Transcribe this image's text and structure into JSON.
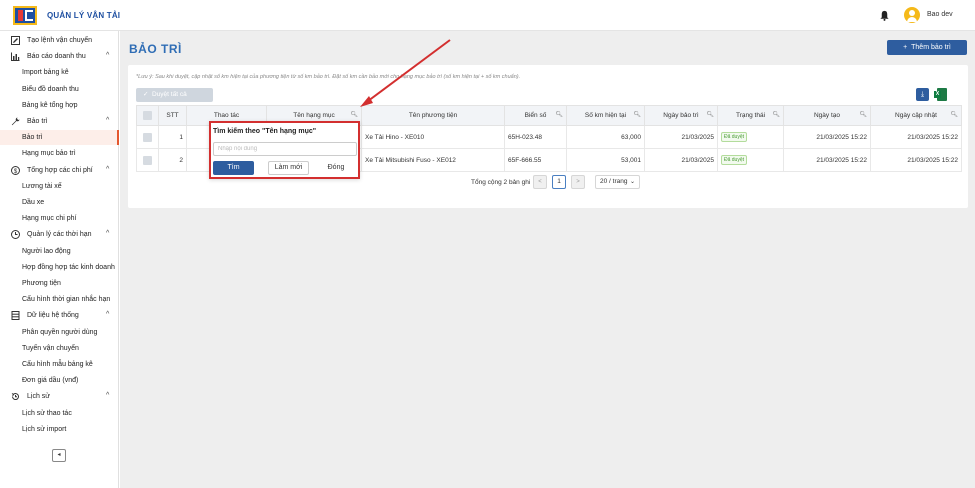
{
  "app": {
    "title": "QUẢN LÝ VẬN TẢI",
    "user": "Bao dev"
  },
  "sidebar": {
    "items": [
      {
        "type": "group",
        "label": "Tạo lệnh vận chuyển",
        "icon": "edit-icon",
        "chevron": ""
      },
      {
        "type": "group",
        "label": "Báo cáo doanh thu",
        "icon": "bar-chart-icon",
        "chevron": "^"
      },
      {
        "type": "sub",
        "label": "Import bảng kê"
      },
      {
        "type": "sub",
        "label": "Biểu đồ doanh thu"
      },
      {
        "type": "sub",
        "label": "Bảng kê tổng hợp"
      },
      {
        "type": "group",
        "label": "Bảo trì",
        "icon": "wrench-icon",
        "chevron": "^"
      },
      {
        "type": "sub",
        "label": "Bảo trì",
        "active": true
      },
      {
        "type": "sub",
        "label": "Hạng mục bảo trì"
      },
      {
        "type": "group",
        "label": "Tổng hợp các chi phí",
        "icon": "money-icon",
        "chevron": "^"
      },
      {
        "type": "sub",
        "label": "Lương tài xế"
      },
      {
        "type": "sub",
        "label": "Dầu xe"
      },
      {
        "type": "sub",
        "label": "Hạng mục chi phí"
      },
      {
        "type": "group",
        "label": "Quản lý các thời hạn",
        "icon": "clock-icon",
        "chevron": "^"
      },
      {
        "type": "sub",
        "label": "Người lao động"
      },
      {
        "type": "sub",
        "label": "Hợp đồng hợp tác kinh doanh"
      },
      {
        "type": "sub",
        "label": "Phương tiện"
      },
      {
        "type": "sub",
        "label": "Cấu hình thời gian nhắc hạn"
      },
      {
        "type": "group",
        "label": "Dữ liệu hệ thống",
        "icon": "database-icon",
        "chevron": "^"
      },
      {
        "type": "sub",
        "label": "Phân quyền người dùng"
      },
      {
        "type": "sub",
        "label": "Tuyến vận chuyển"
      },
      {
        "type": "sub",
        "label": "Cấu hình mẫu bảng kê"
      },
      {
        "type": "sub",
        "label": "Đơn giá dầu (vnđ)"
      },
      {
        "type": "group",
        "label": "Lịch sử",
        "icon": "history-icon",
        "chevron": "^"
      },
      {
        "type": "sub",
        "label": "Lịch sử thao tác"
      },
      {
        "type": "sub",
        "label": "Lịch sử import"
      }
    ],
    "collapse": "◂"
  },
  "page": {
    "title": "BẢO TRÌ",
    "add_button": "Thêm bảo trì",
    "note": "*Lưu ý: Sau khi duyệt, cập nhật số km hiện tại của phương tiện từ số km bảo trì. Đặt số km cần bảo mới cho hạng mục bảo trì (số km hiện tại + số km chuẩn).",
    "approve_all": "Duyệt tất cả"
  },
  "table": {
    "headers": [
      "",
      "STT",
      "Thao tác",
      "Tên hạng mục",
      "Tên phương tiện",
      "Biển số",
      "Số km hiện tại",
      "Ngày bảo trì",
      "Trạng thái",
      "Ngày tạo",
      "Ngày cập nhật"
    ],
    "rows": [
      {
        "stt": "1",
        "vehicle": "Xe Tải Hino - XE010",
        "plate": "65H-023.48",
        "km": "63,000",
        "date": "21/03/2025",
        "status": "Đã duyệt",
        "created": "21/03/2025 15:22",
        "updated": "21/03/2025 15:22"
      },
      {
        "stt": "2",
        "vehicle": "Xe Tải Mitsubishi Fuso - XE012",
        "plate": "65F-666.55",
        "km": "53,001",
        "date": "21/03/2025",
        "status": "Đã duyệt",
        "created": "21/03/2025 15:22",
        "updated": "21/03/2025 15:22"
      }
    ]
  },
  "pager": {
    "total": "Tổng cộng 2 bản ghi",
    "prev": "<",
    "page": "1",
    "next": ">",
    "size": "20 / trang"
  },
  "popover": {
    "title": "Tìm kiếm theo \"Tên hạng mục\"",
    "placeholder": "Nhập nội dung",
    "find": "Tìm",
    "reset": "Làm mới",
    "close": "Đóng"
  },
  "colors": {
    "primary": "#2e5d9f",
    "accent": "#e4572e",
    "highlight": "#d32f2f",
    "title": "#2f6db5"
  }
}
